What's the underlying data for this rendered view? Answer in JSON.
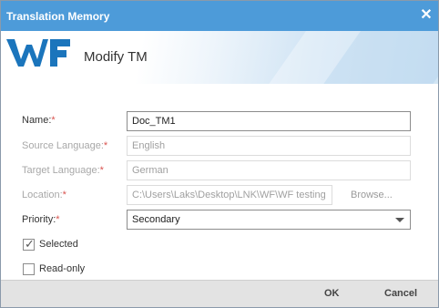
{
  "window": {
    "title": "Translation Memory",
    "close_icon": "close-icon",
    "title_bar_color": "#4d9bd9"
  },
  "banner": {
    "logo_icon": "wf-logo",
    "heading": "Modify TM",
    "logo_color": "#1b75bc"
  },
  "form": {
    "name": {
      "label": "Name:",
      "required_mark": "*",
      "value": "Doc_TM1"
    },
    "source_language": {
      "label": "Source Language:",
      "required_mark": "*",
      "value": "English"
    },
    "target_language": {
      "label": "Target Language:",
      "required_mark": "*",
      "value": "German"
    },
    "location": {
      "label": "Location:",
      "required_mark": "*",
      "value": "C:\\Users\\Laks\\Desktop\\LNK\\WF\\WF testing",
      "browse_label": "Browse..."
    },
    "priority": {
      "label": "Priority:",
      "required_mark": "*",
      "value": "Secondary",
      "dropdown_icon": "chevron-down-icon"
    },
    "selected": {
      "label": "Selected",
      "checked": true
    },
    "read_only": {
      "label": "Read-only",
      "checked": false
    },
    "required_color": "#d9534f"
  },
  "footer": {
    "ok_label": "OK",
    "cancel_label": "Cancel"
  }
}
